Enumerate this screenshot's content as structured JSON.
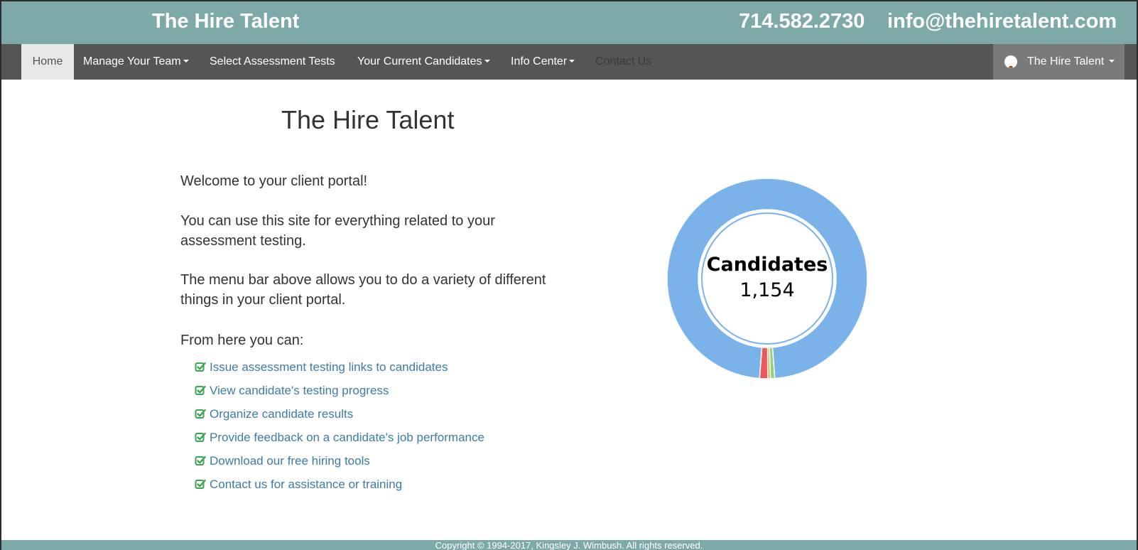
{
  "header": {
    "brand": "The Hire Talent",
    "phone": "714.582.2730",
    "email": "info@thehiretalent.com"
  },
  "nav": {
    "items": [
      {
        "label": "Home"
      },
      {
        "label": "Manage Your Team"
      },
      {
        "label": "Select Assessment Tests"
      },
      {
        "label": "Your Current Candidates"
      },
      {
        "label": "Info Center"
      },
      {
        "label": "Contact Us"
      }
    ],
    "user_menu_label": "The Hire Talent"
  },
  "main": {
    "title": "The Hire Talent",
    "welcome": "Welcome to your client portal!",
    "para_site": "You can use this site for everything related to your assessment testing.",
    "para_menu": "The menu bar above allows you to do a variety of different things in your client portal.",
    "from_here": "From here you can:",
    "features": [
      "Issue assessment testing links to candidates",
      "View candidate's testing progress",
      "Organize candidate results",
      "Provide feedback on a candidate's job performance",
      "Download our free hiring tools",
      "Contact us for assistance or training"
    ]
  },
  "chart_data": {
    "type": "pie",
    "title": "Candidates",
    "center_value": "1,154",
    "slices": [
      {
        "value": 1126,
        "color": "#7ab3e9"
      },
      {
        "value": 8,
        "color": "#8fd27a"
      },
      {
        "value": 5,
        "color": "#e8b04a"
      },
      {
        "value": 15,
        "color": "#e85a5a"
      }
    ]
  },
  "footer": {
    "copyright": "Copyright © 1994-2017, Kingsley J. Wimbush. All rights reserved."
  },
  "colors": {
    "header_bg": "#7daaa9",
    "nav_bg": "#555555",
    "link": "#3e7ba5",
    "check": "#3aa655"
  }
}
